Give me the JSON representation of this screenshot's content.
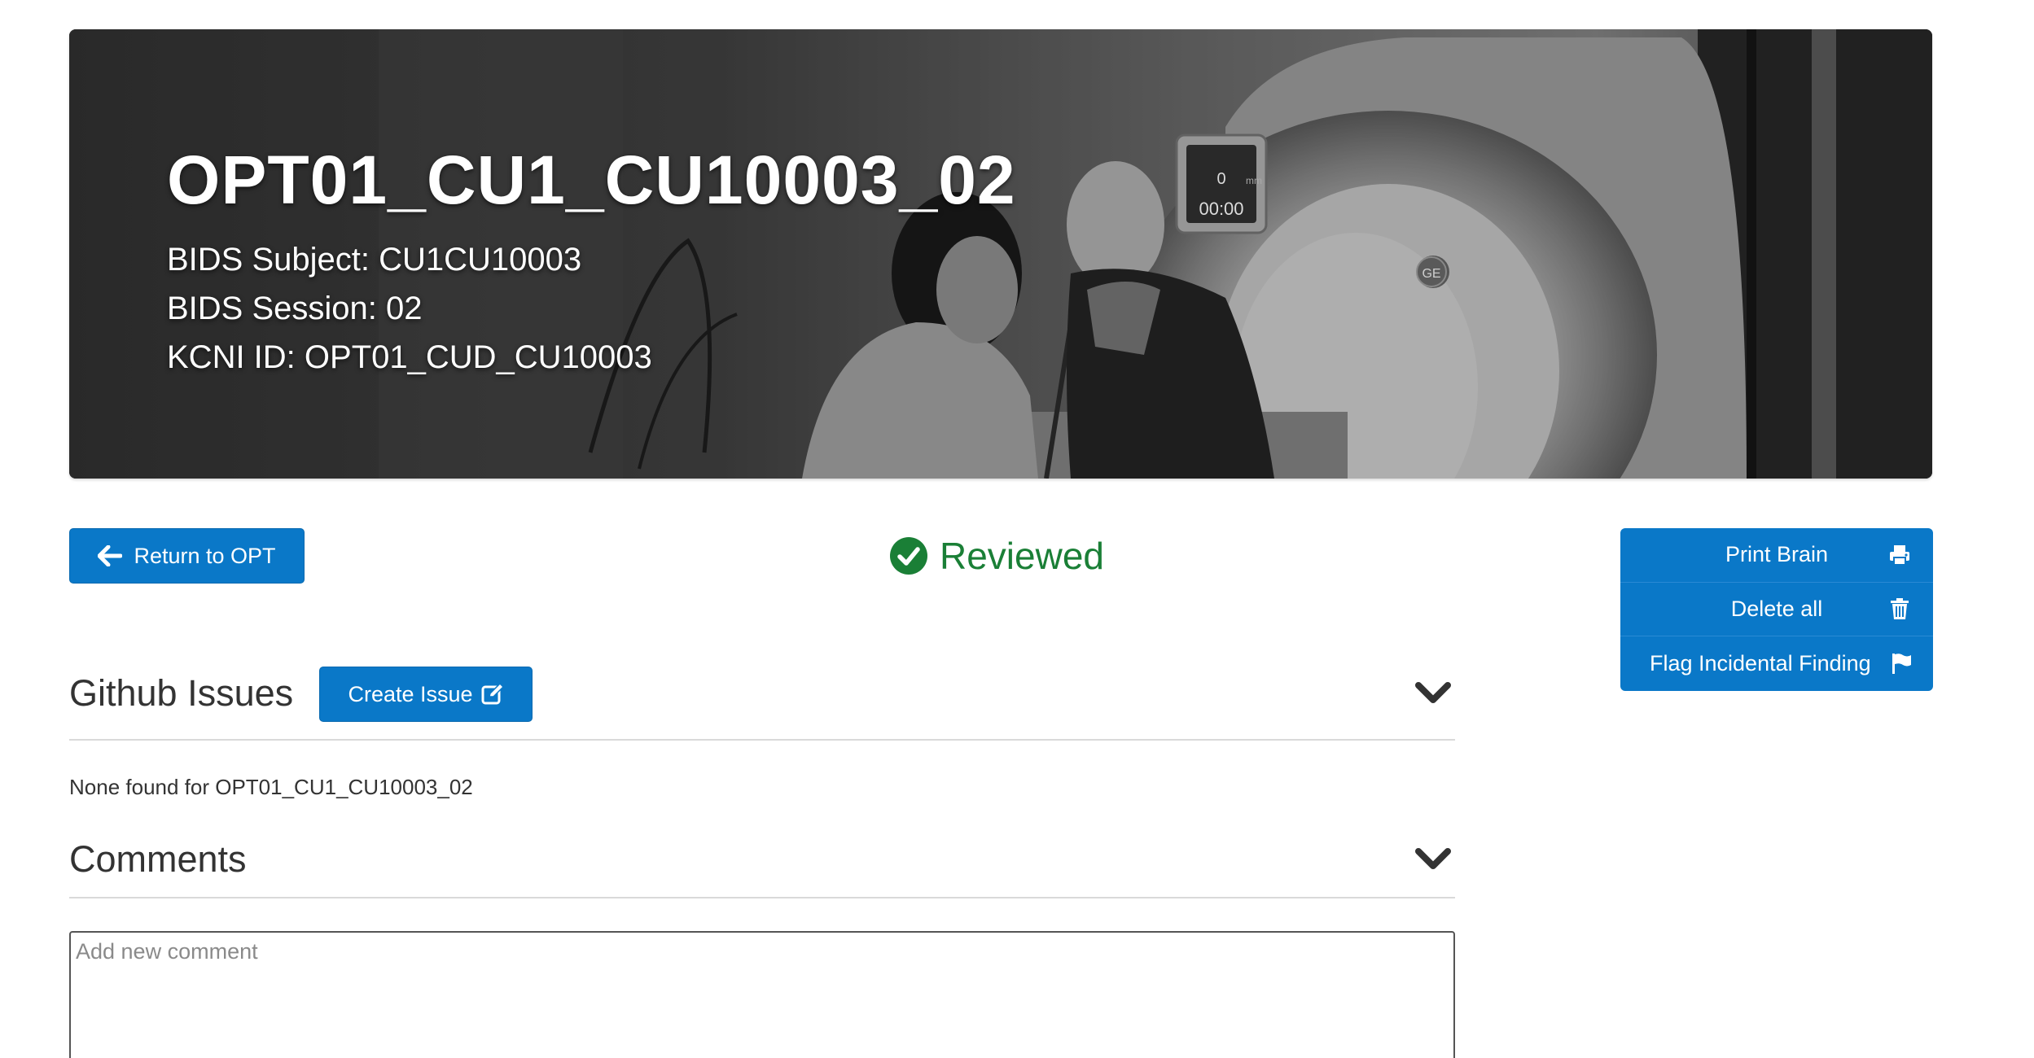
{
  "hero": {
    "title": "OPT01_CU1_CU10003_02",
    "bids_subject": "BIDS Subject: CU1CU10003",
    "bids_session": "BIDS Session: 02",
    "kcni_id": "KCNI ID: OPT01_CUD_CU10003",
    "scanner_display_value": "0",
    "scanner_display_time": "00:00",
    "scanner_display_unit": "mm",
    "scanner_brand": "GE"
  },
  "actions": {
    "return_label": "Return to OPT",
    "status_label": "Reviewed",
    "print_label": "Print Brain",
    "delete_label": "Delete all",
    "flag_label": "Flag Incidental Finding"
  },
  "github": {
    "title": "Github Issues",
    "create_label": "Create Issue",
    "empty_message": "None found for OPT01_CU1_CU10003_02"
  },
  "comments": {
    "title": "Comments",
    "placeholder": "Add new comment",
    "value": ""
  },
  "colors": {
    "primary": "#0a78c8",
    "reviewed": "#1a7f36"
  },
  "icons": {
    "return": "arrow-left-icon",
    "status": "check-circle-icon",
    "print": "printer-icon",
    "delete": "trash-icon",
    "flag": "flag-icon",
    "create": "edit-icon",
    "collapse": "chevron-down-icon"
  }
}
